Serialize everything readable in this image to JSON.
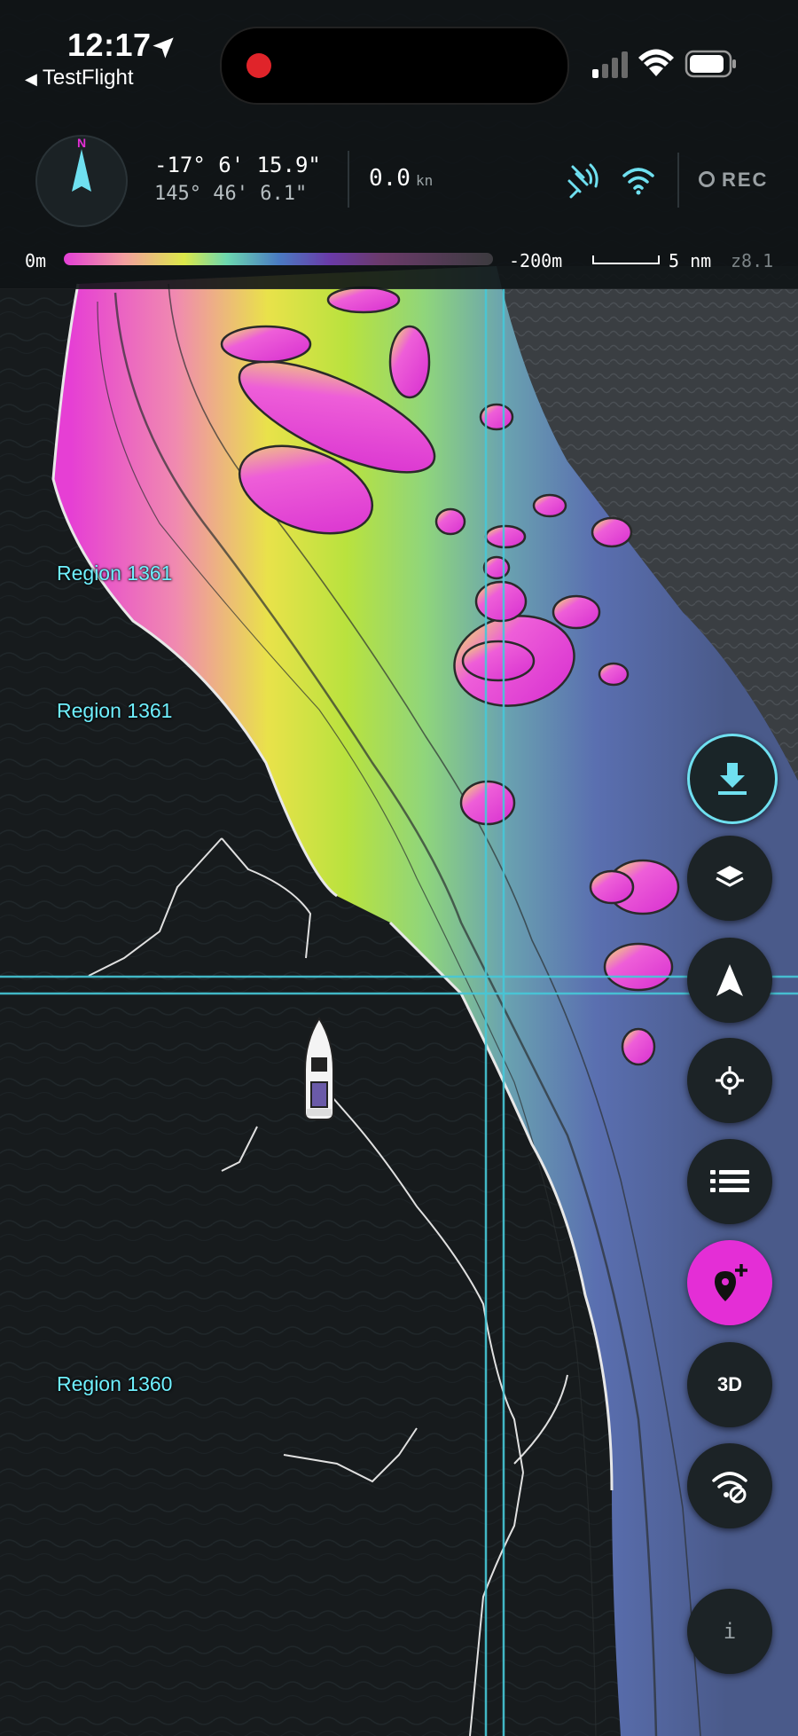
{
  "status_bar": {
    "time": "12:17",
    "back_app": "TestFlight"
  },
  "nav_header": {
    "compass_label": "N",
    "latitude": "-17° 6' 15.9\"",
    "longitude": "145° 46' 6.1\"",
    "speed_value": "0.0",
    "speed_unit": "kn",
    "rec_label": "REC"
  },
  "depth_legend": {
    "min_label": "0m",
    "max_label": "-200m",
    "scale_label": "5 nm",
    "zoom_label": "z8.1"
  },
  "regions": [
    {
      "label": "Region 1361"
    },
    {
      "label": "Region 1361"
    },
    {
      "label": "Region 1360"
    }
  ],
  "controls": {
    "button_3d": "3D",
    "button_info": "i"
  },
  "icons": {
    "compass": "compass-icon",
    "location_arrow": "location-arrow-icon",
    "gps": "satellite-icon",
    "wifi": "wifi-icon",
    "download": "download-icon",
    "layers": "layers-icon",
    "navigate": "navigation-arrow-icon",
    "crosshair": "crosshair-icon",
    "list": "list-icon",
    "add_pin": "add-pin-icon",
    "offline": "wifi-off-icon"
  },
  "colors": {
    "accent": "#6fe0f0",
    "pin_button": "#e42ed6",
    "region_label": "#6ff0ff",
    "record": "#e0242a"
  }
}
